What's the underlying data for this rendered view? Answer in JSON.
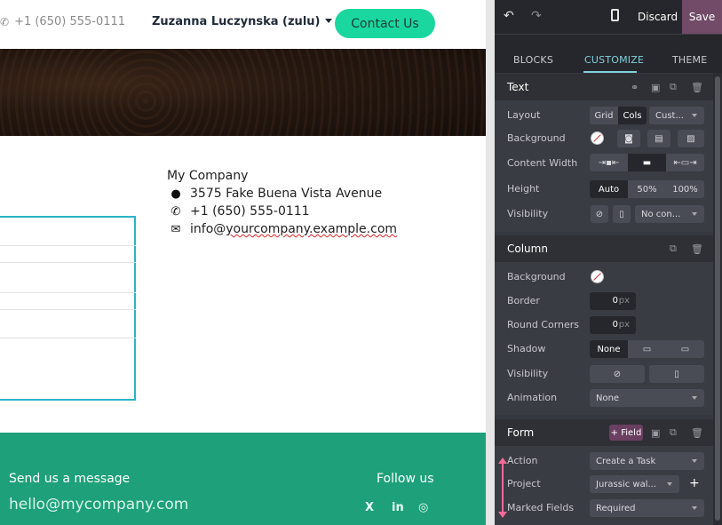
{
  "site": {
    "phone": "+1 (650) 555-0111",
    "user_menu": "Zuzanna Luczynska (zulu)",
    "contact_button": "Contact Us",
    "company": "My Company",
    "address": "3575 Fake Buena Vista Avenue",
    "address_phone": "+1 (650) 555-0111",
    "email_prefix": "info@",
    "email_domain": "yourcompany.example.com",
    "footer": {
      "send_message": "Send us a message",
      "email": "hello@mycompany.com",
      "follow_us": "Follow us",
      "social": [
        "X",
        "in",
        "◎"
      ]
    }
  },
  "editor": {
    "discard": "Discard",
    "save": "Save",
    "tabs": [
      "BLOCKS",
      "CUSTOMIZE",
      "THEME"
    ],
    "active_tab": "CUSTOMIZE",
    "text_section": {
      "title": "Text",
      "layout_label": "Layout",
      "layout_options": [
        "Grid",
        "Cols"
      ],
      "layout_selected": "Cols",
      "layout_custom": "Cust...",
      "background_label": "Background",
      "content_width_label": "Content Width",
      "height_label": "Height",
      "height_options": [
        "Auto",
        "50%",
        "100%"
      ],
      "height_selected": "Auto",
      "visibility_label": "Visibility",
      "visibility_select": "No con..."
    },
    "column_section": {
      "title": "Column",
      "background_label": "Background",
      "border_label": "Border",
      "border_value": "0",
      "border_unit": "px",
      "round_corners_label": "Round Corners",
      "round_value": "0",
      "round_unit": "px",
      "shadow_label": "Shadow",
      "shadow_options": [
        "None"
      ],
      "visibility_label": "Visibility",
      "animation_label": "Animation",
      "animation_value": "None"
    },
    "form_section": {
      "title": "Form",
      "add_field": "+ Field",
      "action_label": "Action",
      "action_value": "Create a Task",
      "project_label": "Project",
      "project_value": "Jurassic wal...",
      "marked_fields_label": "Marked Fields",
      "marked_fields_value": "Required"
    },
    "colors": {
      "accent": "#7fd0dc",
      "save_bg": "#714b67",
      "panel_bg": "#36383f"
    }
  }
}
